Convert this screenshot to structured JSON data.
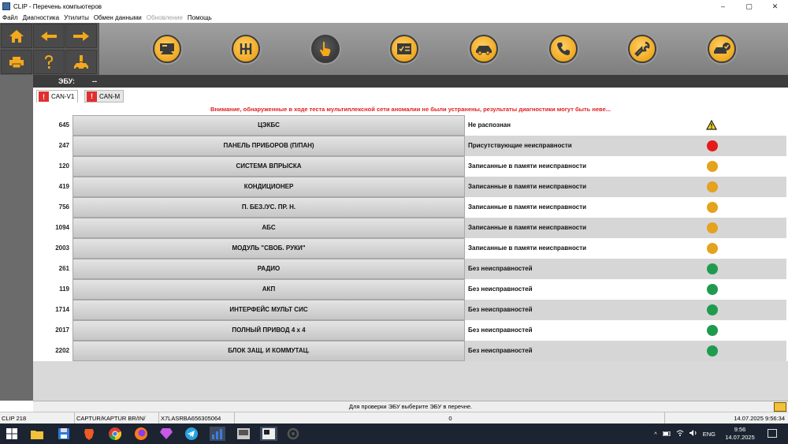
{
  "window": {
    "title": "CLIP - Перечень компьютеров",
    "controls": [
      "–",
      "▢",
      "✕"
    ]
  },
  "menu": [
    {
      "label": "Файл",
      "enabled": true
    },
    {
      "label": "Диагностика",
      "enabled": true
    },
    {
      "label": "Утилиты",
      "enabled": true
    },
    {
      "label": "Обмен данными",
      "enabled": true
    },
    {
      "label": "Обновление",
      "enabled": false
    },
    {
      "label": "Помощь",
      "enabled": true
    }
  ],
  "nav_buttons": [
    {
      "name": "home-icon"
    },
    {
      "name": "arrow-left-icon"
    },
    {
      "name": "arrow-right-icon"
    },
    {
      "name": "printer-icon"
    },
    {
      "name": "help-question-icon"
    },
    {
      "name": "car-warning-icon"
    }
  ],
  "toolbar_icons": [
    {
      "name": "vehicle-identification-icon",
      "active": false
    },
    {
      "name": "gearbox-icon",
      "active": false
    },
    {
      "name": "touch-hand-icon",
      "active": true
    },
    {
      "name": "checklist-icon",
      "active": false
    },
    {
      "name": "car-diagnostic-icon",
      "active": false
    },
    {
      "name": "phone-support-icon",
      "active": false
    },
    {
      "name": "wrench-icon",
      "active": false
    },
    {
      "name": "car-check-icon",
      "active": false
    }
  ],
  "ecu": {
    "label": "ЭБУ:",
    "value": "--"
  },
  "can_tabs": [
    {
      "badge": "!",
      "label": "CAN-V1",
      "active": true
    },
    {
      "badge": "!",
      "label": "CAN-M",
      "active": false
    }
  ],
  "warning": "Внимание, обнаруженные в ходе теста мультиплексной сети аномалии не были устранены, результаты диагностики могут быть неве...",
  "rows": [
    {
      "code": "645",
      "name": "ЦЭКБС",
      "status": "Не распознан",
      "indicator": "warning"
    },
    {
      "code": "247",
      "name": "ПАНЕЛЬ ПРИБОРОВ (П/ПАН)",
      "status": "Присутствующие неисправности",
      "indicator": "red"
    },
    {
      "code": "120",
      "name": "СИСТЕМА ВПРЫСКА",
      "status": "Записанные в памяти неисправности",
      "indicator": "orange"
    },
    {
      "code": "419",
      "name": "КОНДИЦИОНЕР",
      "status": "Записанные в памяти неисправности",
      "indicator": "orange"
    },
    {
      "code": "756",
      "name": "П. БЕЗ./УС. ПР. Н.",
      "status": "Записанные в памяти неисправности",
      "indicator": "orange"
    },
    {
      "code": "1094",
      "name": "АБС",
      "status": "Записанные в памяти неисправности",
      "indicator": "orange"
    },
    {
      "code": "2003",
      "name": "МОДУЛЬ \"СВОБ. РУКИ\"",
      "status": "Записанные в памяти неисправности",
      "indicator": "orange"
    },
    {
      "code": "261",
      "name": "РАДИО",
      "status": "Без неисправностей",
      "indicator": "green"
    },
    {
      "code": "119",
      "name": "АКП",
      "status": "Без неисправностей",
      "indicator": "green"
    },
    {
      "code": "1714",
      "name": "ИНТЕРФЕЙС МУЛЬТ СИС",
      "status": "Без неисправностей",
      "indicator": "green"
    },
    {
      "code": "2017",
      "name": "ПОЛНЫЙ ПРИВОД 4 x 4",
      "status": "Без неисправностей",
      "indicator": "green"
    },
    {
      "code": "2202",
      "name": "БЛОК ЗАЩ. И КОММУТАЦ.",
      "status": "Без неисправностей",
      "indicator": "green"
    }
  ],
  "hint": "Для проверки ЭБУ выберите ЭБУ в перечне.",
  "statusbar": {
    "version": "CLIP 218",
    "vehicle": "CAPTUR/KAPTUR BR/IN/",
    "vin": "X7LASRBA656305064",
    "counter": "0",
    "datetime": "14.07.2025 9:56:34"
  },
  "taskbar": {
    "apps": [
      "windows-start-icon",
      "file-explorer-icon",
      "save-disk-icon",
      "brave-browser-icon",
      "chrome-browser-icon",
      "firefox-browser-icon",
      "app-gem-icon",
      "telegram-icon",
      "chart-app-icon",
      "clip-app-icon",
      "clip-window-icon",
      "settings-gear-icon"
    ],
    "tray": [
      "^",
      "ENG"
    ],
    "time": "9:56",
    "date": "14.07.2025"
  },
  "colors": {
    "accent": "#f0a81f",
    "red": "#e31b1b",
    "orange": "#e4a21d",
    "green": "#1f9b4f",
    "warning_text": "#e02020"
  }
}
